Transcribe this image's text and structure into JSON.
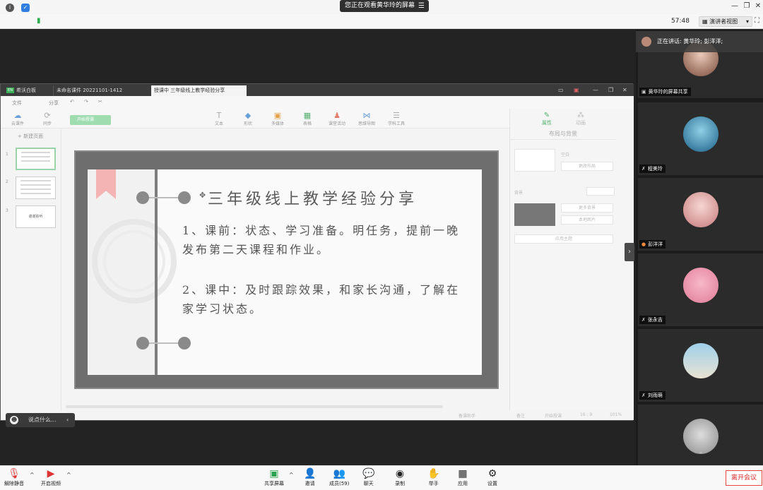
{
  "topbar": {
    "sharing_label": "您正在观看黄华玲的屏幕",
    "menu_icon": "menu-icon"
  },
  "inforow": {
    "timer": "57:48",
    "view_label": "演讲者视图"
  },
  "app": {
    "tabs": {
      "logo": "希沃白板",
      "file": "未命名课件 20221101-1412",
      "active": "授课中 三年级线上教学经验分享"
    },
    "toolbar1": {
      "file": "文件",
      "share": "分享"
    },
    "tools": {
      "cloud": "云课件",
      "sync": "同步",
      "start": "开始授课",
      "text": "文本",
      "shape": "形状",
      "media": "多媒体",
      "table": "表格",
      "activity": "课堂活动",
      "mindmap": "思维导图",
      "subject": "学科工具"
    },
    "leftpanel": {
      "new_page": "新建页面",
      "nums": [
        "1",
        "2",
        "3"
      ],
      "thumb3_text": "谢谢聆听"
    },
    "slide": {
      "title": "三年级线上教学经验分享",
      "p1": "1、课前：状态、学习准备。明任务，提前一晚发布第二天课程和作业。",
      "p2": "2、课中：及时跟踪效果，和家长沟通，了解在家学习状态。"
    },
    "rightpanel": {
      "tab_prop": "属性",
      "tab_anim": "动画",
      "header": "布局与背景",
      "blank": "空白",
      "change_layout": "更改布局",
      "bg": "背景",
      "more_bg": "更多背景",
      "local_img": "本地图片",
      "apply_theme": "应用主题"
    },
    "status": {
      "assist": "备课助手",
      "note": "备注",
      "start": "开始授课",
      "ratio": "16 : 9",
      "zoom": "101%"
    }
  },
  "chat": {
    "placeholder": "说点什么..."
  },
  "participants": {
    "speaking": "正在讲话: 黄华玲; 彭洋洋;",
    "tiles": [
      {
        "name": "黄华玲的屏幕共享"
      },
      {
        "name": "程美玲"
      },
      {
        "name": "彭洋洋"
      },
      {
        "name": "张永吉"
      },
      {
        "name": "刘雨萌"
      }
    ]
  },
  "bottom": {
    "mute": "解除静音",
    "video": "开启视频",
    "share": "共享屏幕",
    "invite": "邀请",
    "members": "成员(59)",
    "chat": "聊天",
    "record": "录制",
    "raise": "举手",
    "apps": "应用",
    "settings": "设置",
    "leave": "离开会议"
  }
}
